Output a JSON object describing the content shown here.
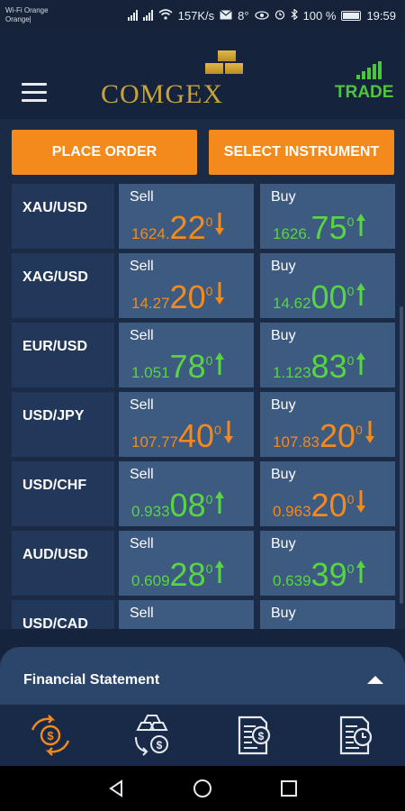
{
  "status_bar": {
    "carrier_line1": "Wi-Fi Orange",
    "carrier_line2": "Orange|",
    "speed": "157K/s",
    "temperature": "8°",
    "battery": "100 %",
    "time": "19:59"
  },
  "header": {
    "logo": "COMGEX",
    "trade_label": "TRADE"
  },
  "actions": {
    "place_order": "PLACE ORDER",
    "select_instrument": "SELECT INSTRUMENT"
  },
  "quotes": {
    "sell_label": "Sell",
    "buy_label": "Buy",
    "rows": [
      {
        "symbol": "XAU/USD",
        "sell": {
          "prefix": "1624.",
          "big": "22",
          "sup": "0",
          "direction": "down"
        },
        "buy": {
          "prefix": "1626.",
          "big": "75",
          "sup": "0",
          "direction": "up"
        }
      },
      {
        "symbol": "XAG/USD",
        "sell": {
          "prefix": "14.27",
          "big": "20",
          "sup": "0",
          "direction": "down"
        },
        "buy": {
          "prefix": "14.62",
          "big": "00",
          "sup": "0",
          "direction": "up"
        }
      },
      {
        "symbol": "EUR/USD",
        "sell": {
          "prefix": "1.051",
          "big": "78",
          "sup": "0",
          "direction": "up"
        },
        "buy": {
          "prefix": "1.123",
          "big": "83",
          "sup": "0",
          "direction": "up"
        }
      },
      {
        "symbol": "USD/JPY",
        "sell": {
          "prefix": "107.77",
          "big": "40",
          "sup": "0",
          "direction": "down"
        },
        "buy": {
          "prefix": "107.83",
          "big": "20",
          "sup": "0",
          "direction": "down"
        }
      },
      {
        "symbol": "USD/CHF",
        "sell": {
          "prefix": "0.933",
          "big": "08",
          "sup": "0",
          "direction": "up"
        },
        "buy": {
          "prefix": "0.963",
          "big": "20",
          "sup": "0",
          "direction": "down"
        }
      },
      {
        "symbol": "AUD/USD",
        "sell": {
          "prefix": "0.609",
          "big": "28",
          "sup": "0",
          "direction": "up"
        },
        "buy": {
          "prefix": "0.639",
          "big": "39",
          "sup": "0",
          "direction": "up"
        }
      },
      {
        "symbol": "USD/CAD",
        "sell": {
          "prefix": "",
          "big": "",
          "sup": "",
          "direction": ""
        },
        "buy": {
          "prefix": "",
          "big": "",
          "sup": "",
          "direction": ""
        }
      }
    ]
  },
  "financial_statement": {
    "title": "Financial Statement"
  },
  "colors": {
    "accent_orange": "#f38a1b",
    "up_green": "#58d542",
    "logo_gold": "#c9a23a",
    "trade_green": "#4ec53c"
  },
  "tabs": [
    {
      "icon": "currency-exchange-icon",
      "active": true
    },
    {
      "icon": "gold-bars-exchange-icon",
      "active": false
    },
    {
      "icon": "dollar-document-icon",
      "active": false
    },
    {
      "icon": "document-clock-icon",
      "active": false
    }
  ]
}
